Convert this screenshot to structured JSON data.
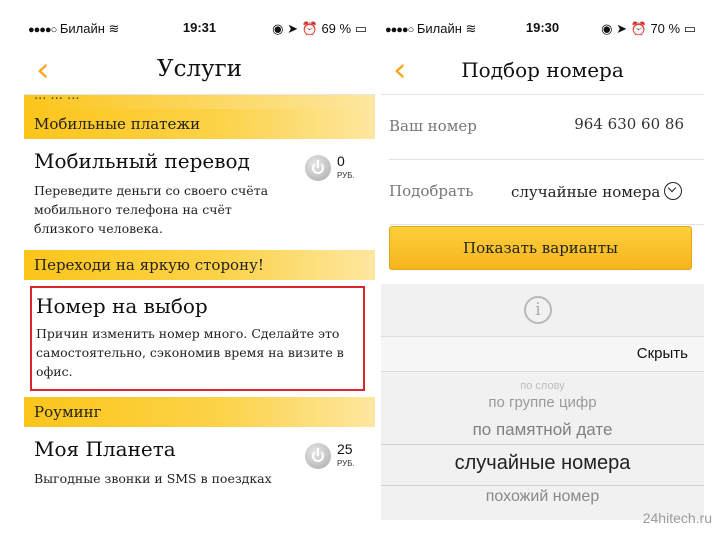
{
  "left": {
    "status": {
      "carrier": "Билайн",
      "time": "19:31",
      "battery": "69 %"
    },
    "nav": {
      "back_glyph": "‹",
      "title": "Услуги"
    },
    "cutoff_text": "... ... ...",
    "sections": {
      "mobile_payments": "Мобильные платежи",
      "bright_side": "Переходи на яркую сторону!",
      "roaming": "Роуминг"
    },
    "services": {
      "transfer": {
        "name": "Мобильный перевод",
        "desc": "Переведите деньги со своего счёта мобильного телефона на счёт близкого человека.",
        "amount": "0",
        "currency": "РУБ."
      },
      "number_choice": {
        "name": "Номер на выбор",
        "desc": "Причин изменить номер много. Сделайте это самостоятельно, сэкономив время на визите в офис."
      },
      "planet": {
        "name": "Моя Планета",
        "desc": "Выгодные звонки и SMS в поездках",
        "amount": "25",
        "currency": "РУБ."
      }
    }
  },
  "right": {
    "status": {
      "carrier": "Билайн",
      "time": "19:30",
      "battery": "70 %"
    },
    "nav": {
      "back_glyph": "‹",
      "title": "Подбор номера"
    },
    "your_number": {
      "label": "Ваш номер",
      "value": "964 630 60 86"
    },
    "choose": {
      "label": "Подобрать",
      "value": "случайные номера"
    },
    "show_button": "Показать варианты",
    "info_glyph": "i",
    "hide_label": "Скрыть",
    "wheel_options": [
      "по слову",
      "по группе цифр",
      "по памятной дате",
      "случайные номера",
      "похожий номер"
    ]
  },
  "watermark": "24hitech.ru",
  "colors": {
    "accent": "#f5a623",
    "highlight_border": "#d9262c",
    "section_bar": "#fbc51a"
  }
}
